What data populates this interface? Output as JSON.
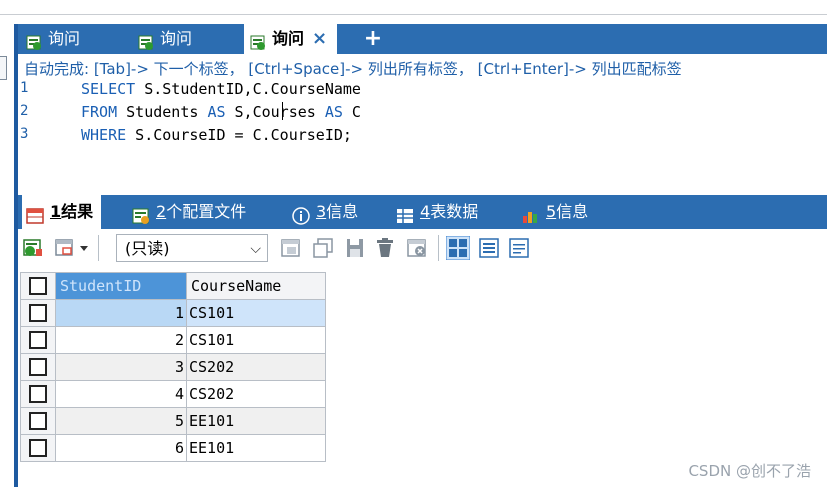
{
  "query_tabs": [
    {
      "label": "询问",
      "active": false
    },
    {
      "label": "询问",
      "active": false
    },
    {
      "label": "询问",
      "active": true
    }
  ],
  "tab_add": "+",
  "tab_close": "×",
  "editor": {
    "autocomplete_hint": "自动完成: [Tab]-> 下一个标签， [Ctrl+Space]-> 列出所有标签， [Ctrl+Enter]-> 列出匹配标签",
    "lines": [
      {
        "n": "1",
        "kw1": "SELECT",
        "t1": " S.StudentID,C.CourseName",
        "kw2": "",
        "t2": "",
        "kw3": "",
        "t3": ""
      },
      {
        "n": "2",
        "kw1": "FROM",
        "t1": " Students ",
        "kw2": "AS",
        "t2": " S,Courses ",
        "kw3": "AS",
        "t3": " C"
      },
      {
        "n": "3",
        "kw1": "WHERE",
        "t1": " S.CourseID = C.CourseID;",
        "kw2": "",
        "t2": "",
        "kw3": "",
        "t3": ""
      }
    ]
  },
  "result_tabs": [
    {
      "num": "1",
      "label": " 结果",
      "active": true,
      "icon": "table-grid-icon"
    },
    {
      "num": "2",
      "label": " 个配置文件",
      "active": false,
      "icon": "profile-icon"
    },
    {
      "num": "3",
      "label": " 信息",
      "active": false,
      "icon": "info-icon"
    },
    {
      "num": "4",
      "label": " 表数据",
      "active": false,
      "icon": "table-data-icon"
    },
    {
      "num": "5",
      "label": " 信息",
      "active": false,
      "icon": "chart-icon"
    }
  ],
  "toolbar": {
    "mode_select": "(只读)"
  },
  "grid": {
    "columns": [
      "StudentID",
      "CourseName"
    ],
    "rows": [
      {
        "id": "1",
        "course": "CS101"
      },
      {
        "id": "2",
        "course": "CS101"
      },
      {
        "id": "3",
        "course": "CS202"
      },
      {
        "id": "4",
        "course": "CS202"
      },
      {
        "id": "5",
        "course": "EE101"
      },
      {
        "id": "6",
        "course": "EE101"
      }
    ]
  },
  "watermark": "CSDN @创不了浩",
  "colors": {
    "accent": "#2c6db1",
    "selection": "#b9d8f5",
    "header_selected": "#4d94d8"
  }
}
